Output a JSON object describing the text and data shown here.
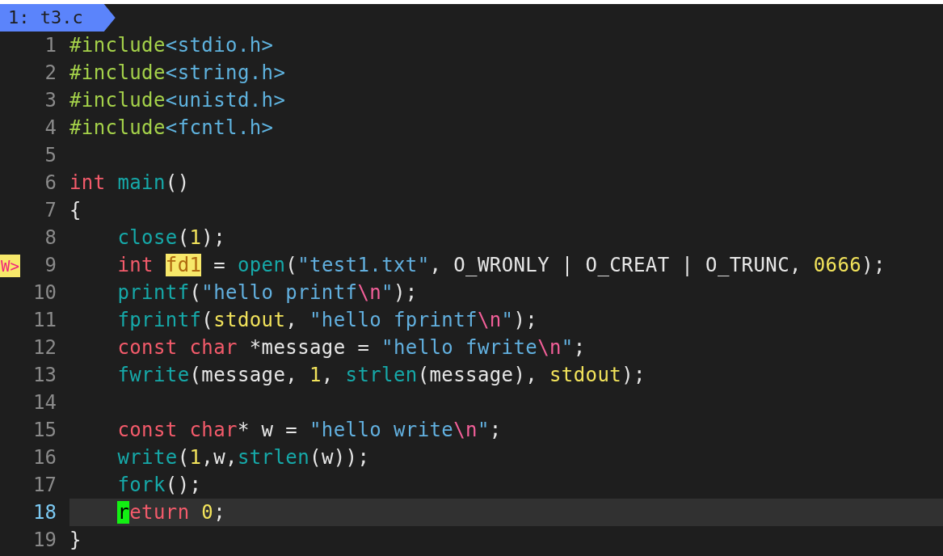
{
  "tab": {
    "label": "1: t3.c"
  },
  "lines": [
    {
      "number": "1",
      "current": false,
      "indented": false,
      "tokens": [
        {
          "kind": "include",
          "text": "#include"
        },
        {
          "kind": "header",
          "text": "<stdio.h>"
        }
      ]
    },
    {
      "number": "2",
      "current": false,
      "indented": false,
      "tokens": [
        {
          "kind": "include",
          "text": "#include"
        },
        {
          "kind": "header",
          "text": "<string.h>"
        }
      ]
    },
    {
      "number": "3",
      "current": false,
      "indented": false,
      "tokens": [
        {
          "kind": "include",
          "text": "#include"
        },
        {
          "kind": "header",
          "text": "<unistd.h>"
        }
      ]
    },
    {
      "number": "4",
      "current": false,
      "indented": false,
      "tokens": [
        {
          "kind": "include",
          "text": "#include"
        },
        {
          "kind": "header",
          "text": "<fcntl.h>"
        }
      ]
    },
    {
      "number": "5",
      "current": false,
      "indented": false
    },
    {
      "number": "6",
      "current": false,
      "indented": false,
      "tokens": [
        {
          "kind": "keyword",
          "text": "int"
        },
        {
          "kind": "function",
          "text": "main",
          "space_before": true
        },
        {
          "kind": "plain",
          "text": "()"
        }
      ]
    },
    {
      "number": "7",
      "current": false,
      "indented": false,
      "tokens": [
        {
          "kind": "plain",
          "text": "{"
        }
      ]
    },
    {
      "number": "8",
      "current": false,
      "indented": true,
      "tokens": [
        {
          "kind": "function",
          "text": "close"
        },
        {
          "kind": "plain",
          "text": "("
        },
        {
          "kind": "number",
          "text": "1"
        },
        {
          "kind": "plain",
          "text": ");"
        }
      ]
    },
    {
      "number": "9",
      "current": false,
      "indented": true,
      "sign": "W>",
      "tokens": [
        {
          "kind": "keyword",
          "text": "int"
        },
        {
          "kind": "match",
          "text": "fd1",
          "space_before": true
        },
        {
          "kind": "plain",
          "text": " = "
        },
        {
          "kind": "function",
          "text": "open"
        },
        {
          "kind": "plain",
          "text": "("
        },
        {
          "kind": "string",
          "text": "\"test1.txt\""
        },
        {
          "kind": "plain",
          "text": ", O_WRONLY | O_CREAT | O_TRUNC, "
        },
        {
          "kind": "number",
          "text": "0666"
        },
        {
          "kind": "plain",
          "text": ");"
        }
      ]
    },
    {
      "number": "10",
      "current": false,
      "indented": true,
      "tokens": [
        {
          "kind": "function",
          "text": "printf"
        },
        {
          "kind": "plain",
          "text": "("
        },
        {
          "kind": "string",
          "text": "\"hello printf"
        },
        {
          "kind": "escape",
          "text": "\\n"
        },
        {
          "kind": "string",
          "text": "\""
        },
        {
          "kind": "plain",
          "text": ");"
        }
      ]
    },
    {
      "number": "11",
      "current": false,
      "indented": true,
      "tokens": [
        {
          "kind": "function",
          "text": "fprintf"
        },
        {
          "kind": "plain",
          "text": "("
        },
        {
          "kind": "constant",
          "text": "stdout"
        },
        {
          "kind": "plain",
          "text": ", "
        },
        {
          "kind": "string",
          "text": "\"hello fprintf"
        },
        {
          "kind": "escape",
          "text": "\\n"
        },
        {
          "kind": "string",
          "text": "\""
        },
        {
          "kind": "plain",
          "text": ");"
        }
      ]
    },
    {
      "number": "12",
      "current": false,
      "indented": true,
      "tokens": [
        {
          "kind": "keyword",
          "text": "const"
        },
        {
          "kind": "keyword",
          "text": "char",
          "space_before": true
        },
        {
          "kind": "plain",
          "text": " *message = "
        },
        {
          "kind": "string",
          "text": "\"hello fwrite"
        },
        {
          "kind": "escape",
          "text": "\\n"
        },
        {
          "kind": "string",
          "text": "\""
        },
        {
          "kind": "plain",
          "text": ";"
        }
      ]
    },
    {
      "number": "13",
      "current": false,
      "indented": true,
      "tokens": [
        {
          "kind": "function",
          "text": "fwrite"
        },
        {
          "kind": "plain",
          "text": "(message, "
        },
        {
          "kind": "number",
          "text": "1"
        },
        {
          "kind": "plain",
          "text": ", "
        },
        {
          "kind": "function",
          "text": "strlen"
        },
        {
          "kind": "plain",
          "text": "(message), "
        },
        {
          "kind": "constant",
          "text": "stdout"
        },
        {
          "kind": "plain",
          "text": ");"
        }
      ]
    },
    {
      "number": "14",
      "current": false,
      "indented": false
    },
    {
      "number": "15",
      "current": false,
      "indented": true,
      "tokens": [
        {
          "kind": "keyword",
          "text": "const"
        },
        {
          "kind": "keyword",
          "text": "char",
          "space_before": true
        },
        {
          "kind": "plain",
          "text": "* w = "
        },
        {
          "kind": "string",
          "text": "\"hello write"
        },
        {
          "kind": "escape",
          "text": "\\n"
        },
        {
          "kind": "string",
          "text": "\""
        },
        {
          "kind": "plain",
          "text": ";"
        }
      ]
    },
    {
      "number": "16",
      "current": false,
      "indented": true,
      "tokens": [
        {
          "kind": "function",
          "text": "write"
        },
        {
          "kind": "plain",
          "text": "("
        },
        {
          "kind": "number",
          "text": "1"
        },
        {
          "kind": "plain",
          "text": ",w,"
        },
        {
          "kind": "function",
          "text": "strlen"
        },
        {
          "kind": "plain",
          "text": "(w));"
        }
      ]
    },
    {
      "number": "17",
      "current": false,
      "indented": true,
      "tokens": [
        {
          "kind": "function",
          "text": "fork"
        },
        {
          "kind": "plain",
          "text": "();"
        }
      ]
    },
    {
      "number": "18",
      "current": true,
      "indented": true,
      "tokens": [
        {
          "kind": "cursor",
          "text": "r"
        },
        {
          "kind": "keyword",
          "text": "eturn"
        },
        {
          "kind": "number",
          "text": "0",
          "space_before": true
        },
        {
          "kind": "plain",
          "text": ";"
        }
      ]
    },
    {
      "number": "19",
      "current": false,
      "indented": false,
      "tokens": [
        {
          "kind": "plain",
          "text": "}"
        }
      ]
    }
  ]
}
